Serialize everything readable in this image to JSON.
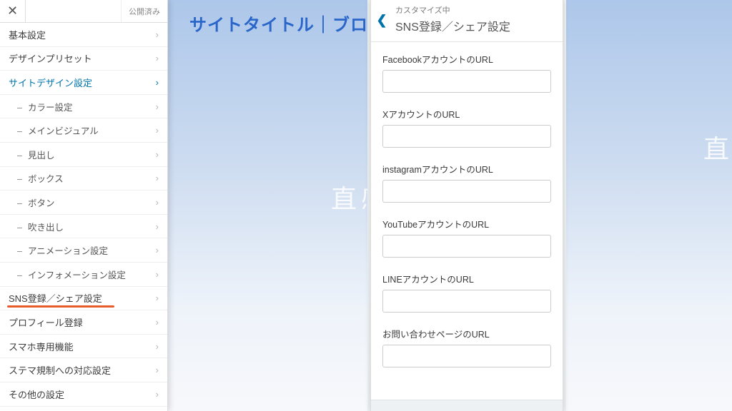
{
  "preview": {
    "site_title": "サイトタイトル｜ブログ名",
    "word_center": "直感",
    "word_right": "直"
  },
  "sidebar_top": {
    "published_label": "公開済み"
  },
  "sidebar": {
    "items": [
      {
        "label": "基本設定",
        "type": "item"
      },
      {
        "label": "デザインプリセット",
        "type": "item"
      },
      {
        "label": "サイトデザイン設定",
        "type": "item",
        "active": true
      },
      {
        "label": "カラー設定",
        "type": "sub"
      },
      {
        "label": "メインビジュアル",
        "type": "sub"
      },
      {
        "label": "見出し",
        "type": "sub"
      },
      {
        "label": "ボックス",
        "type": "sub"
      },
      {
        "label": "ボタン",
        "type": "sub"
      },
      {
        "label": "吹き出し",
        "type": "sub"
      },
      {
        "label": "アニメーション設定",
        "type": "sub"
      },
      {
        "label": "インフォメーション設定",
        "type": "sub"
      },
      {
        "label": "SNS登録／シェア設定",
        "type": "item",
        "highlight": true
      },
      {
        "label": "プロフィール登録",
        "type": "item"
      },
      {
        "label": "スマホ専用機能",
        "type": "item"
      },
      {
        "label": "ステマ規制への対応設定",
        "type": "item"
      },
      {
        "label": "その他の設定",
        "type": "item"
      }
    ]
  },
  "panel": {
    "supertitle": "カスタマイズ中",
    "title": "SNS登録／シェア設定",
    "fields": [
      {
        "label": "FacebookアカウントのURL",
        "value": ""
      },
      {
        "label": "XアカウントのURL",
        "value": ""
      },
      {
        "label": "instagramアカウントのURL",
        "value": ""
      },
      {
        "label": "YouTubeアカウントのURL",
        "value": ""
      },
      {
        "label": "LINEアカウントのURL",
        "value": ""
      },
      {
        "label": "お問い合わせページのURL",
        "value": ""
      }
    ]
  }
}
